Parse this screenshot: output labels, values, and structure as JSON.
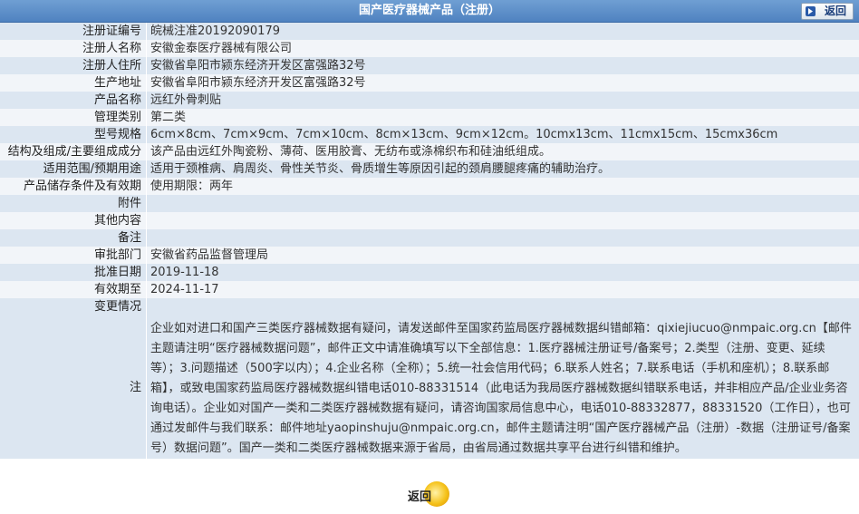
{
  "header": {
    "title": "国产医疗器械产品（注册）",
    "back_label": "返回"
  },
  "rows": [
    {
      "label": "注册证编号",
      "value": "皖械注准20192090179"
    },
    {
      "label": "注册人名称",
      "value": "安徽金泰医疗器械有限公司"
    },
    {
      "label": "注册人住所",
      "value": "安徽省阜阳市颍东经济开发区富强路32号"
    },
    {
      "label": "生产地址",
      "value": "安徽省阜阳市颍东经济开发区富强路32号"
    },
    {
      "label": "产品名称",
      "value": "远红外骨刺贴"
    },
    {
      "label": "管理类别",
      "value": "第二类"
    },
    {
      "label": "型号规格",
      "value": "6cm×8cm、7cm×9cm、7cm×10cm、8cm×13cm、9cm×12cm。10cmx13cm、11cmx15cm、15cmx36cm"
    },
    {
      "label": "结构及组成/主要组成成分",
      "value": "该产品由远红外陶瓷粉、薄荷、医用胶膏、无纺布或涤棉织布和硅油纸组成。"
    },
    {
      "label": "适用范围/预期用途",
      "value": "适用于颈椎病、肩周炎、骨性关节炎、骨质增生等原因引起的颈肩腰腿疼痛的辅助治疗。"
    },
    {
      "label": "产品储存条件及有效期",
      "value": "使用期限：两年"
    },
    {
      "label": "附件",
      "value": ""
    },
    {
      "label": "其他内容",
      "value": ""
    },
    {
      "label": "备注",
      "value": ""
    },
    {
      "label": "审批部门",
      "value": "安徽省药品监督管理局"
    },
    {
      "label": "批准日期",
      "value": "2019-11-18"
    },
    {
      "label": "有效期至",
      "value": "2024-11-17"
    },
    {
      "label": "变更情况",
      "value": ""
    }
  ],
  "note": {
    "label": "注",
    "text": "企业如对进口和国产三类医疗器械数据有疑问，请发送邮件至国家药监局医疗器械数据纠错邮箱：qixiejiucuo@nmpaic.org.cn【邮件主题请注明“医疗器械数据问题”，邮件正文中请准确填写以下全部信息：1.医疗器械注册证号/备案号；2.类型（注册、变更、延续等）；3.问题描述（500字以内）；4.企业名称（全称）；5.统一社会信用代码；6.联系人姓名；7.联系电话（手机和座机）；8.联系邮箱】，或致电国家药监局医疗器械数据纠错电话010-88331514（此电话为我局医疗器械数据纠错联系电话，并非相应产品/企业业务咨询电话）。企业如对国产一类和二类医疗器械数据有疑问，请咨询国家局信息中心，电话010-88332877，88331520（工作日），也可通过发邮件与我们联系：邮件地址yaopinshuju@nmpaic.org.cn，邮件主题请注明“国产医疗器械产品（注册）-数据（注册证号/备案号）数据问题”。国产一类和二类医疗器械数据来源于省局，由省局通过数据共享平台进行纠错和维护。"
  },
  "footer": {
    "back_label": "返回"
  }
}
